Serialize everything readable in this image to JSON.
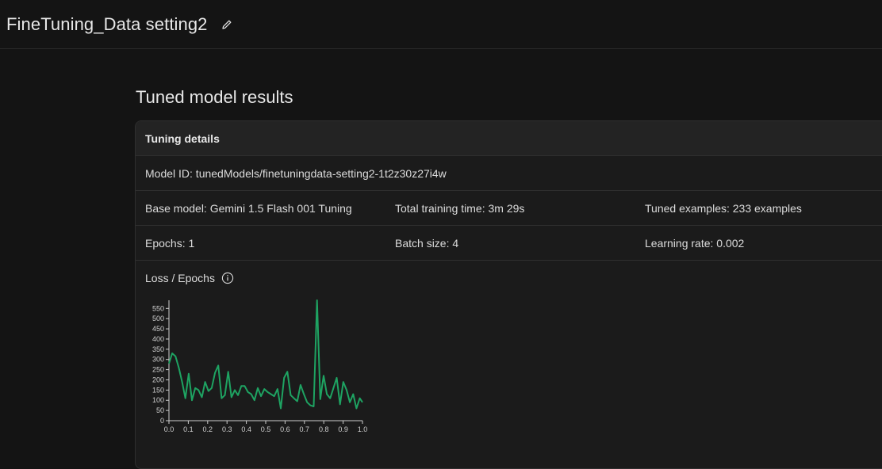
{
  "header": {
    "title": "FineTuning_Data setting2",
    "edit_icon": "pencil-icon"
  },
  "main": {
    "section_title": "Tuned model results",
    "card": {
      "header": "Tuning details",
      "model_id": "Model ID: tunedModels/finetuningdata-setting2-1t2z30z27i4w",
      "base_model": "Base model: Gemini 1.5 Flash 001 Tuning",
      "training_time": "Total training time: 3m 29s",
      "tuned_examples": "Tuned examples: 233 examples",
      "epochs": "Epochs: 1",
      "batch_size": "Batch size: 4",
      "learning_rate": "Learning rate: 0.002",
      "chart_label": "Loss / Epochs",
      "info_icon": "info-icon"
    }
  },
  "colors": {
    "background": "#141414",
    "card": "#1b1b1b",
    "card_header": "#232323",
    "line": "#1ea362"
  },
  "chart_data": {
    "type": "line",
    "xlim": [
      0,
      1
    ],
    "ylim": [
      0,
      590
    ],
    "x_ticks": [
      "0.0",
      "0.1",
      "0.2",
      "0.3",
      "0.4",
      "0.5",
      "0.6",
      "0.7",
      "0.8",
      "0.9",
      "1.0"
    ],
    "y_ticks": [
      "0",
      "50",
      "100",
      "150",
      "200",
      "250",
      "300",
      "350",
      "400",
      "450",
      "500",
      "550"
    ],
    "x": [
      0.0,
      0.017,
      0.034,
      0.051,
      0.068,
      0.085,
      0.102,
      0.119,
      0.136,
      0.153,
      0.17,
      0.187,
      0.204,
      0.221,
      0.238,
      0.255,
      0.272,
      0.289,
      0.306,
      0.323,
      0.34,
      0.357,
      0.374,
      0.391,
      0.408,
      0.425,
      0.442,
      0.459,
      0.476,
      0.493,
      0.51,
      0.527,
      0.544,
      0.561,
      0.578,
      0.595,
      0.612,
      0.629,
      0.646,
      0.663,
      0.68,
      0.697,
      0.714,
      0.731,
      0.748,
      0.765,
      0.782,
      0.799,
      0.816,
      0.833,
      0.85,
      0.867,
      0.884,
      0.901,
      0.918,
      0.935,
      0.952,
      0.969,
      0.986,
      1.0
    ],
    "series": [
      {
        "values": [
          280,
          330,
          315,
          260,
          190,
          110,
          230,
          100,
          160,
          150,
          115,
          190,
          145,
          160,
          235,
          270,
          110,
          125,
          240,
          115,
          150,
          125,
          170,
          170,
          140,
          130,
          100,
          160,
          120,
          155,
          140,
          130,
          120,
          155,
          60,
          210,
          240,
          125,
          110,
          95,
          175,
          130,
          90,
          75,
          70,
          590,
          105,
          220,
          130,
          110,
          160,
          210,
          80,
          190,
          150,
          90,
          130,
          60,
          110,
          90
        ]
      }
    ]
  }
}
